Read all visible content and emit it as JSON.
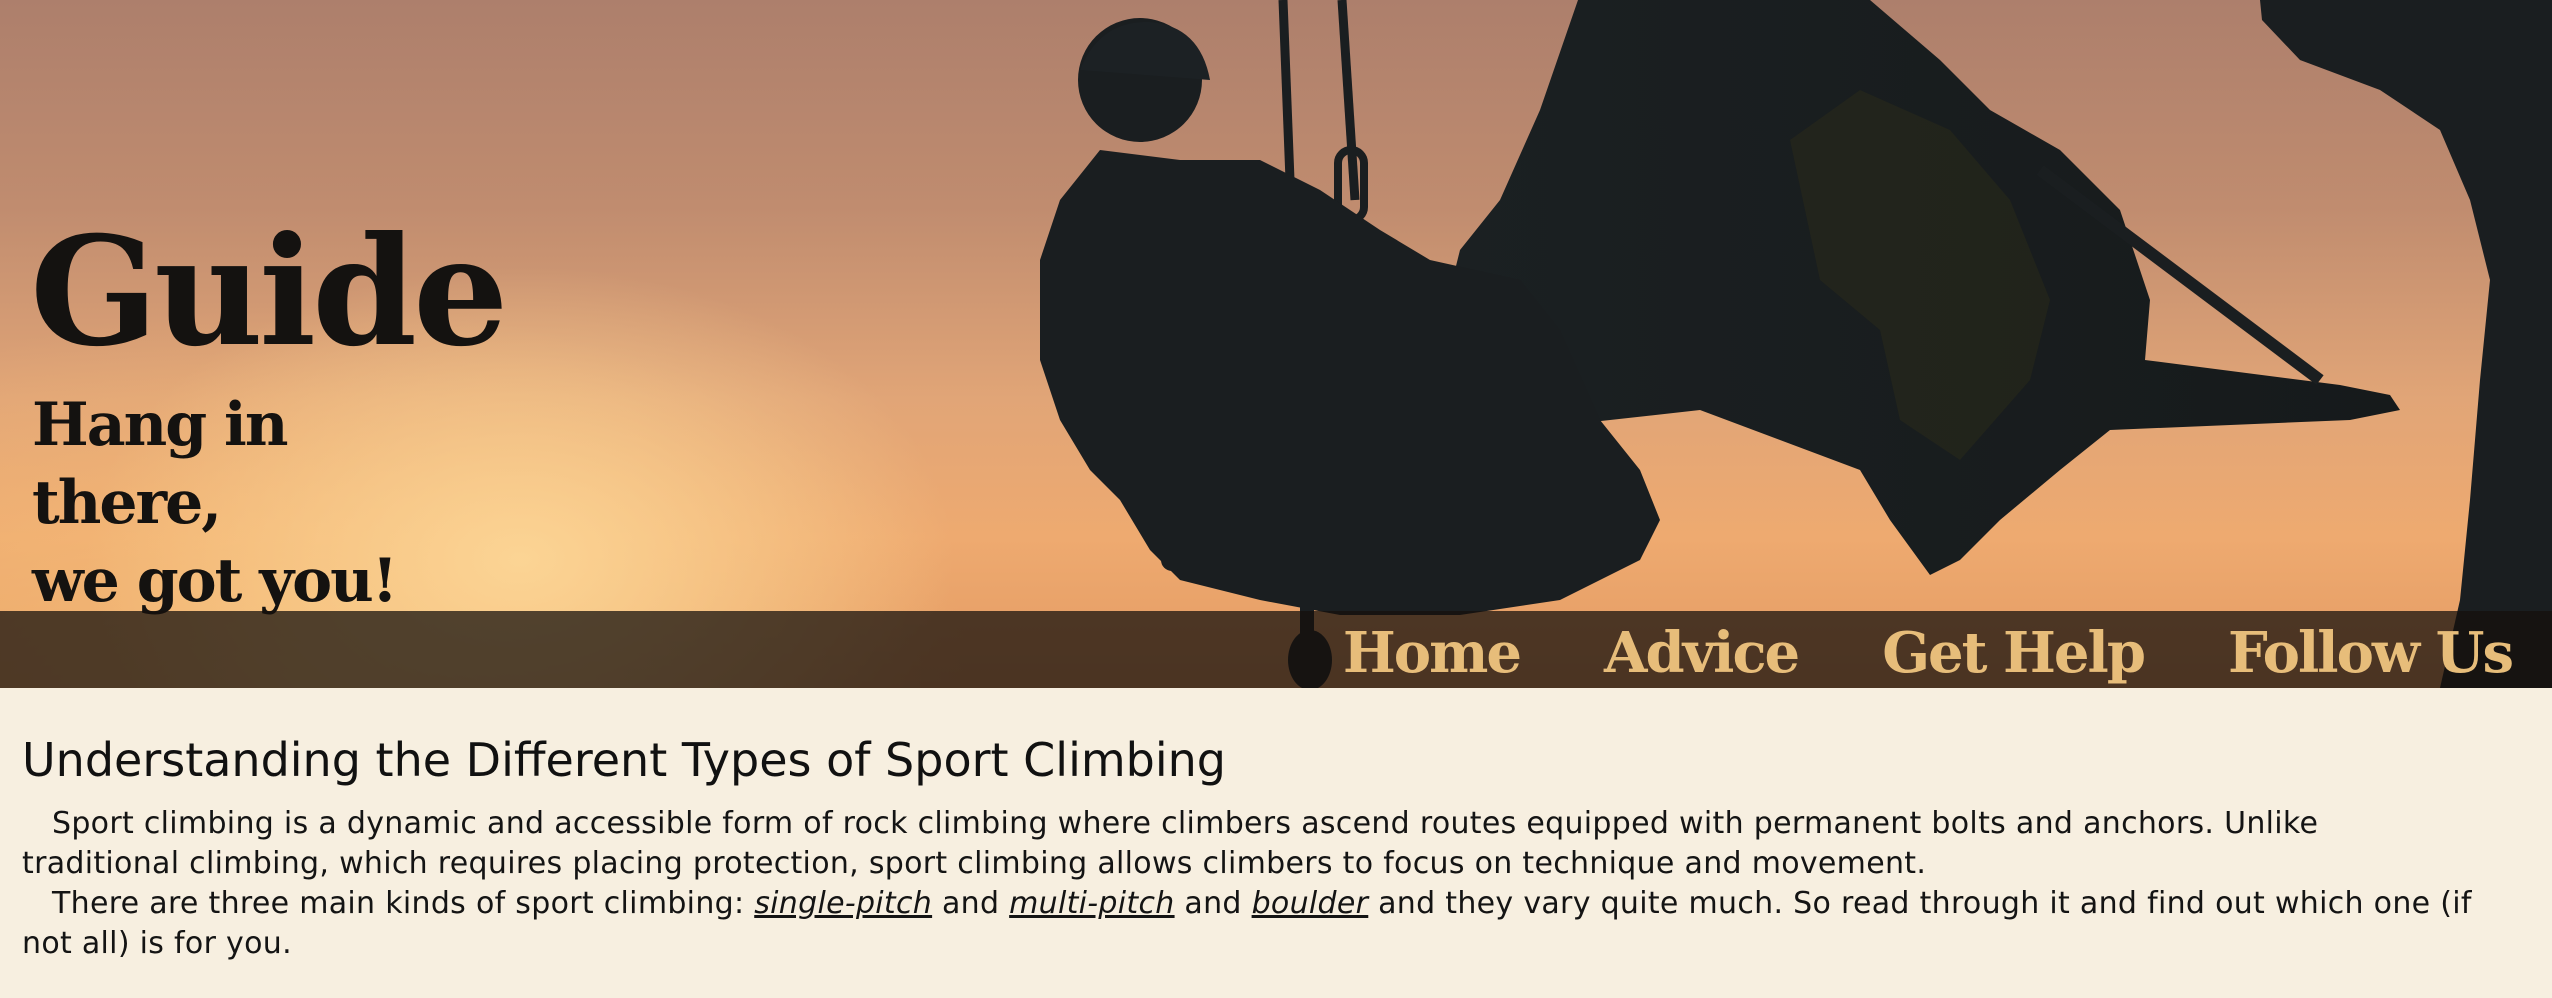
{
  "hero": {
    "title": "Guide",
    "tagline_line1": "Hang in there,",
    "tagline_line2": "we got you!"
  },
  "nav": {
    "items": [
      {
        "label": "Home"
      },
      {
        "label": "Advice"
      },
      {
        "label": "Get Help"
      },
      {
        "label": "Follow Us"
      }
    ]
  },
  "article": {
    "heading": "Understanding the Different Types of Sport Climbing",
    "paragraph1": "Sport climbing is a dynamic and accessible form of rock climbing where climbers ascend routes equipped with permanent bolts and anchors. Unlike traditional climbing, which requires placing protection, sport climbing allows climbers to focus on technique and movement.",
    "paragraph2": {
      "intro": "There are three main kinds of sport climbing: ",
      "link1": "single-pitch",
      "sep1": " and ",
      "link2": "multi-pitch",
      "sep2": " and ",
      "link3": "boulder",
      "outro": " and they vary quite much. So read through it and find out which one (if not all) is for you."
    }
  },
  "colors": {
    "page_background": "#f7efe0",
    "nav_text": "#e7bd7a",
    "nav_bar": "#16100c",
    "silhouette": "#1a1e20",
    "body_text": "#141414"
  }
}
